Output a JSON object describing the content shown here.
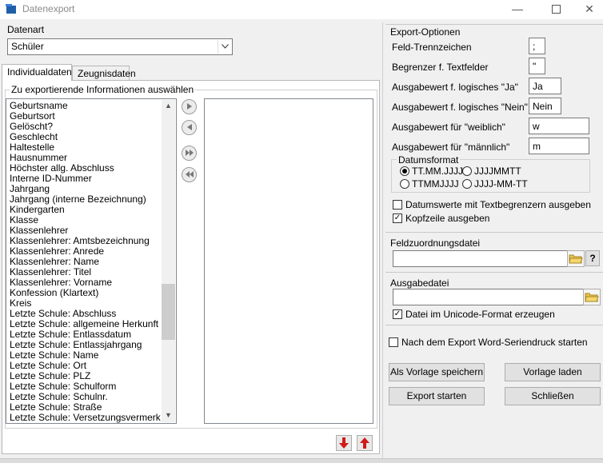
{
  "window": {
    "title": "Datenexport"
  },
  "left": {
    "datenart_label": "Datenart",
    "datenart_value": "Schüler",
    "tabs": [
      {
        "label": "Individualdaten"
      },
      {
        "label": "Zeugnisdaten"
      }
    ],
    "group_title": "Zu exportierende Informationen auswählen",
    "available_items": [
      "Geburtsname",
      "Geburtsort",
      "Gelöscht?",
      "Geschlecht",
      "Haltestelle",
      "Hausnummer",
      "Höchster allg. Abschluss",
      "Interne ID-Nummer",
      "Jahrgang",
      "Jahrgang (interne Bezeichnung)",
      "Kindergarten",
      "Klasse",
      "Klassenlehrer",
      "Klassenlehrer: Amtsbezeichnung",
      "Klassenlehrer: Anrede",
      "Klassenlehrer: Name",
      "Klassenlehrer: Titel",
      "Klassenlehrer: Vorname",
      "Konfession (Klartext)",
      "Kreis",
      "Letzte Schule: Abschluss",
      "Letzte Schule: allgemeine Herkunft",
      "Letzte Schule: Entlassdatum",
      "Letzte Schule: Entlassjahrgang",
      "Letzte Schule: Name",
      "Letzte Schule: Ort",
      "Letzte Schule: PLZ",
      "Letzte Schule: Schulform",
      "Letzte Schule: Schulnr.",
      "Letzte Schule: Straße",
      "Letzte Schule: Versetzungsvermerk"
    ],
    "selected_items": []
  },
  "right": {
    "export_title": "Export-Optionen",
    "fields": [
      {
        "label": "Feld-Trennzeichen",
        "value": ";"
      },
      {
        "label": "Begrenzer f. Textfelder",
        "value": "\""
      },
      {
        "label": "Ausgabewert f. logisches \"Ja\"",
        "value": "Ja"
      },
      {
        "label": "Ausgabewert f. logisches \"Nein\"",
        "value": "Nein"
      },
      {
        "label": "Ausgabewert für \"weiblich\"",
        "value": "w"
      },
      {
        "label": "Ausgabewert für \"männlich\"",
        "value": "m"
      }
    ],
    "datumsformat_title": "Datumsformat",
    "date_formats": [
      {
        "label": "TT.MM.JJJJ",
        "selected": true
      },
      {
        "label": "JJJJMMTT",
        "selected": false
      },
      {
        "label": "TTMMJJJJ",
        "selected": false
      },
      {
        "label": "JJJJ-MM-TT",
        "selected": false
      }
    ],
    "chk_datum": {
      "label": "Datumswerte mit Textbegrenzern ausgeben",
      "checked": false
    },
    "chk_kopf": {
      "label": "Kopfzeile ausgeben",
      "checked": true
    },
    "feldzuordnung_title": "Feldzuordnungsdatei",
    "feldzuordnung_value": "",
    "help_label": "?",
    "ausgabe_title": "Ausgabedatei",
    "ausgabe_value": "",
    "chk_unicode": {
      "label": "Datei im Unicode-Format erzeugen",
      "checked": true
    },
    "chk_word": {
      "label": "Nach dem Export Word-Seriendruck starten",
      "checked": false
    },
    "buttons": {
      "save_template": "Als Vorlage speichern",
      "load_template": "Vorlage laden",
      "start_export": "Export starten",
      "close": "Schließen"
    }
  },
  "colors": {
    "arrow_red": "#d11a1a"
  }
}
